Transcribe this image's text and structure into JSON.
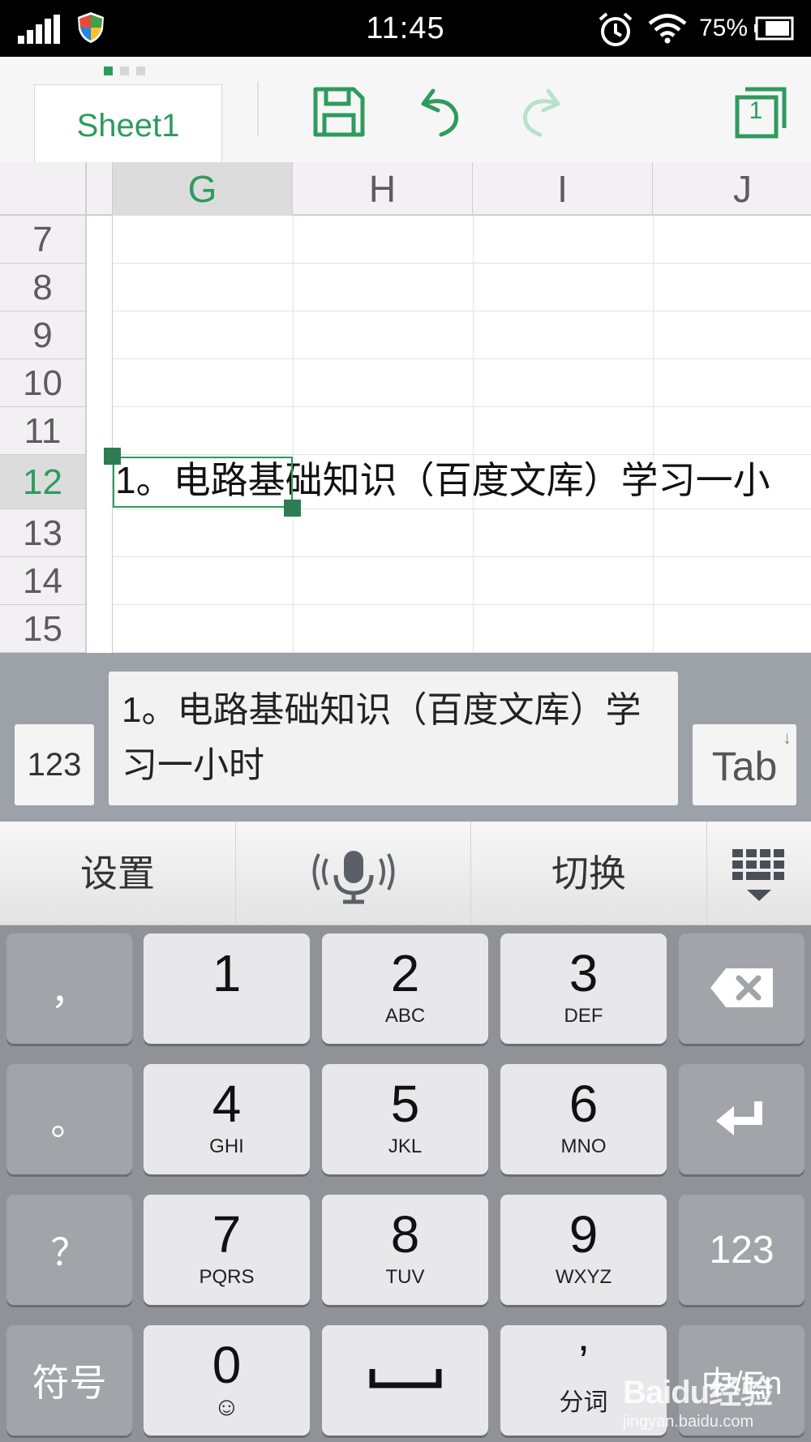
{
  "status_bar": {
    "time": "11:45",
    "battery_percent": "75%",
    "icons": [
      "signal-icon",
      "shield-icon",
      "alarm-icon",
      "wifi-icon",
      "battery-icon"
    ]
  },
  "toolbar": {
    "page_indicator": {
      "count": 3,
      "active": 1
    },
    "sheet_tab_label": "Sheet1",
    "page_count": "1",
    "icons": [
      "save-icon",
      "undo-icon",
      "redo-icon",
      "pages-icon"
    ],
    "accent_color": "#2e9b5e"
  },
  "sheet": {
    "columns": [
      "G",
      "H",
      "I",
      "J"
    ],
    "active_column": "G",
    "rows": [
      "7",
      "8",
      "9",
      "10",
      "11",
      "12",
      "13",
      "14",
      "15"
    ],
    "active_row": "12",
    "cell_G12_text": "1。电路基础知识（百度文库）学习一小"
  },
  "edit_bar": {
    "mode_button": "123",
    "input_value": "1。电路基础知识（百度文库）学习一小时",
    "tab_button": "Tab"
  },
  "ime_strip": {
    "settings": "设置",
    "voice_icon": "microphone-icon",
    "switch": "切换",
    "collapse_icon": "hide-keyboard-icon"
  },
  "keyboard": {
    "side_left": [
      "，",
      "。",
      "？",
      "符号"
    ],
    "keys": [
      {
        "num": "1",
        "sub": ""
      },
      {
        "num": "2",
        "sub": "ABC"
      },
      {
        "num": "3",
        "sub": "DEF"
      },
      {
        "num": "4",
        "sub": "GHI"
      },
      {
        "num": "5",
        "sub": "JKL"
      },
      {
        "num": "6",
        "sub": "MNO"
      },
      {
        "num": "7",
        "sub": "PQRS"
      },
      {
        "num": "8",
        "sub": "TUV"
      },
      {
        "num": "9",
        "sub": "WXYZ"
      }
    ],
    "bottom": {
      "zero": "0",
      "zero_sub": "☺",
      "space_icon": "space-icon",
      "apostrophe": "’",
      "segment": "分词"
    },
    "side_right": {
      "delete_icon": "backspace-icon",
      "enter_icon": "enter-icon",
      "mode": "123",
      "lang": "中/En"
    }
  },
  "watermark": {
    "brand": "Baidu经验",
    "url": "jingyan.baidu.com"
  }
}
